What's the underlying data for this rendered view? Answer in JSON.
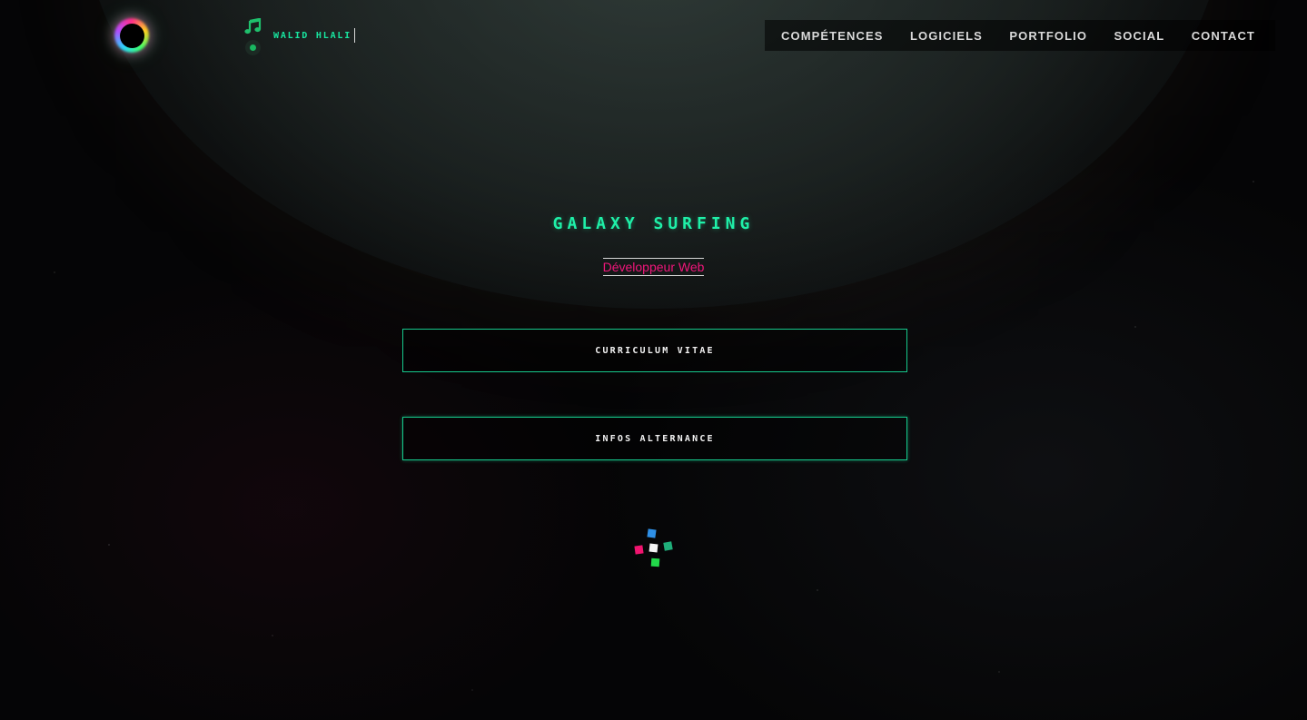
{
  "header": {
    "brand_name": "Walid Hlali",
    "nav": [
      {
        "label": "COMPÉTENCES"
      },
      {
        "label": "LOGICIELS"
      },
      {
        "label": "PORTFOLIO"
      },
      {
        "label": "SOCIAL"
      },
      {
        "label": "CONTACT"
      }
    ],
    "icons": {
      "logo": "rainbow-ring-logo-icon",
      "music": "music-note-icon",
      "music_toggle": "toggle-dot-icon"
    }
  },
  "hero": {
    "title": "Galaxy Surfing",
    "subtitle": "Développeur Web",
    "buttons": [
      {
        "label": "Curriculum Vitae"
      },
      {
        "label": "Infos Alternance"
      }
    ]
  },
  "colors": {
    "accent_green": "#1ff0a8",
    "accent_pink": "#f0167a",
    "button_border": "#16c98c",
    "loader": [
      "#2e8fe6",
      "#1fae7a",
      "#f4f4f4",
      "#f0146e",
      "#22d94a"
    ]
  }
}
